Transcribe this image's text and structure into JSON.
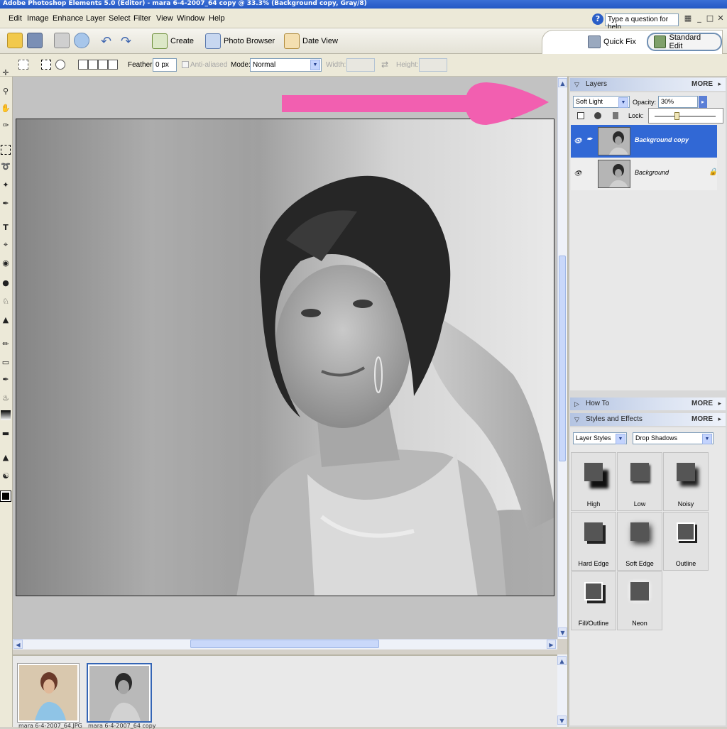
{
  "titlebar": {
    "text": "Adobe Photoshop Elements 5.0 (Editor) - mara 6-4-2007_64 copy @ 33.3% (Background copy, Gray/8)"
  },
  "menu": [
    "Edit",
    "Image",
    "Enhance",
    "Layer",
    "Select",
    "Filter",
    "View",
    "Window",
    "Help"
  ],
  "help": {
    "placeholder": "Type a question for help",
    "q_icon": "help-icon"
  },
  "shortcuts": {
    "create": "Create",
    "photo_browser": "Photo Browser",
    "date_view": "Date View"
  },
  "modes": {
    "quick_fix": "Quick Fix",
    "standard_edit": "Standard Edit"
  },
  "options": {
    "feather_label": "Feather:",
    "feather_value": "0 px",
    "anti_aliased": "Anti-aliased",
    "mode_label": "Mode:",
    "mode_value": "Normal",
    "width_label": "Width:",
    "height_label": "Height:"
  },
  "layers_panel": {
    "title": "Layers",
    "more": "MORE",
    "blend_mode": "Soft Light",
    "opacity_label": "Opacity:",
    "opacity_value": "30%",
    "lock_label": "Lock:",
    "layers": [
      {
        "name": "Background copy",
        "selected": true
      },
      {
        "name": "Background",
        "locked": true
      }
    ]
  },
  "howto_panel": {
    "title": "How To",
    "more": "MORE"
  },
  "styles_panel": {
    "title": "Styles and Effects",
    "more": "MORE",
    "category": "Layer Styles",
    "subcategory": "Drop Shadows",
    "styles": [
      "High",
      "Low",
      "Noisy",
      "Hard Edge",
      "Soft Edge",
      "Outline",
      "Fill/Outline",
      "Neon"
    ]
  },
  "photo_bin": {
    "items": [
      {
        "label": "mara 6-4-2007_64.JPG"
      },
      {
        "label": "mara 6-4-2007_64 copy"
      }
    ]
  },
  "annotation": {
    "arrow_color": "#f25fb0"
  },
  "colors": {
    "selected_layer": "#3168d5",
    "accent": "#2b5fc7"
  }
}
